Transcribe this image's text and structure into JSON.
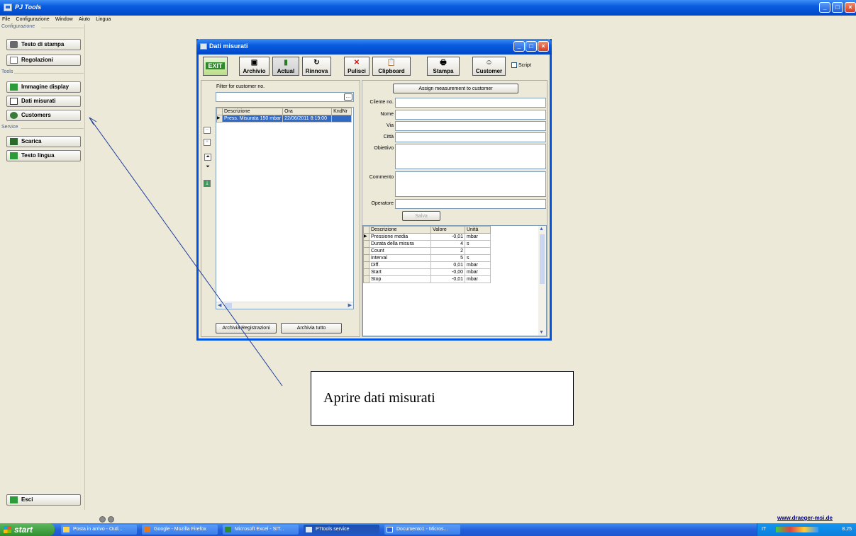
{
  "app": {
    "title": "PJ Tools"
  },
  "menu": [
    "File",
    "Configurazione",
    "Window",
    "Aiuto",
    "Lingua"
  ],
  "sidebar": {
    "sections": [
      {
        "label": "Configurazione",
        "items": [
          "Testo di stampa",
          "Regolazioni"
        ]
      },
      {
        "label": "Tools",
        "items": [
          "Immagine display",
          "Dati misurati",
          "Customers"
        ]
      },
      {
        "label": "Service",
        "items": [
          "Scarica",
          "Testo lingua"
        ]
      }
    ],
    "exit_label": "Esci"
  },
  "dialog": {
    "title": "Dati misurati",
    "toolbar": {
      "exit": "EXIT",
      "archivio": "Archivio",
      "actual": "Actual",
      "rinnova": "Rinnova",
      "pulisci": "Pulisci",
      "clipboard": "Clipboard",
      "stampa": "Stampa",
      "customer": "Customer",
      "script": "Script"
    },
    "left": {
      "filter_label": "Filter for customer no.",
      "filter_value": "",
      "columns": [
        "Descrizione",
        "Ora",
        "KndNr"
      ],
      "rows": [
        [
          "Press. Misurata 150 mbar",
          "22/06/2011 8:19:00",
          ""
        ]
      ],
      "archive_button": "Archivia Registrazioni",
      "archive_all_button": "Archivia tutto"
    },
    "right": {
      "assign_button": "Assign measurement to customer",
      "fields": [
        {
          "label": "Cliente no.",
          "value": ""
        },
        {
          "label": "Nome",
          "value": ""
        },
        {
          "label": "Via",
          "value": ""
        },
        {
          "label": "Città",
          "value": ""
        }
      ],
      "obiettivo_label": "Obiettivo",
      "commento_label": "Commento",
      "operatore_label": "Operatore",
      "save_button": "Salva",
      "columns": [
        "Descrizione",
        "Valore",
        "Unità"
      ],
      "rows": [
        [
          "Pressione media",
          "-0,01",
          "mbar"
        ],
        [
          "Durata della misura",
          "4",
          "s"
        ],
        [
          "Count",
          "2",
          ""
        ],
        [
          "Interval",
          "5",
          "s"
        ],
        [
          "Diff.",
          "0,01",
          "mbar"
        ],
        [
          "Start",
          "-0,00",
          "mbar"
        ],
        [
          "Stop",
          "-0,01",
          "mbar"
        ]
      ]
    }
  },
  "callout": {
    "text": "Aprire dati misurati"
  },
  "footer": {
    "url": "www.draeger-msi.de"
  },
  "taskbar": {
    "start": "start",
    "tasks": [
      "Posta in arrivo - Outl...",
      "Google - Mozilla Firefox",
      "Microsoft Excel - SIT...",
      "P7tools service",
      "Documento1 - Micros..."
    ],
    "tray_lang": "IT",
    "clock": "8.25"
  }
}
